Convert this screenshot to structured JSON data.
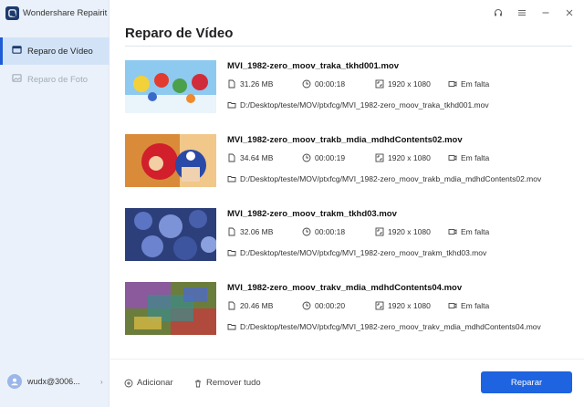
{
  "app": {
    "name": "Wondershare Repairit"
  },
  "sidebar": {
    "items": [
      {
        "label": "Reparo de Vídeo",
        "state": "active"
      },
      {
        "label": "Reparo de Foto",
        "state": "disabled"
      }
    ],
    "user": {
      "name": "wudx@3006..."
    }
  },
  "main": {
    "title": "Reparo de Vídeo",
    "files": [
      {
        "name": "MVI_1982-zero_moov_traka_tkhd001.mov",
        "size": "31.26 MB",
        "duration": "00:00:18",
        "resolution": "1920 x 1080",
        "status": "Em falta",
        "path": "D:/Desktop/teste/MOV/ptxfcg/MVI_1982-zero_moov_traka_tkhd001.mov"
      },
      {
        "name": "MVI_1982-zero_moov_trakb_mdia_mdhdContents02.mov",
        "size": "34.64 MB",
        "duration": "00:00:19",
        "resolution": "1920 x 1080",
        "status": "Em falta",
        "path": "D:/Desktop/teste/MOV/ptxfcg/MVI_1982-zero_moov_trakb_mdia_mdhdContents02.mov"
      },
      {
        "name": "MVI_1982-zero_moov_trakm_tkhd03.mov",
        "size": "32.06 MB",
        "duration": "00:00:18",
        "resolution": "1920 x 1080",
        "status": "Em falta",
        "path": "D:/Desktop/teste/MOV/ptxfcg/MVI_1982-zero_moov_trakm_tkhd03.mov"
      },
      {
        "name": "MVI_1982-zero_moov_trakv_mdia_mdhdContents04.mov",
        "size": "20.46 MB",
        "duration": "00:00:20",
        "resolution": "1920 x 1080",
        "status": "Em falta",
        "path": "D:/Desktop/teste/MOV/ptxfcg/MVI_1982-zero_moov_trakv_mdia_mdhdContents04.mov"
      }
    ]
  },
  "footer": {
    "add_label": "Adicionar",
    "remove_all_label": "Remover tudo",
    "repair_label": "Reparar"
  },
  "colors": {
    "accent": "#1e63e0",
    "sidebar_bg": "#eaf1fa",
    "active_item_bg": "#d3e3f7"
  },
  "icons": {
    "window": [
      "headset-icon",
      "menu-icon",
      "minimize-icon",
      "close-icon"
    ],
    "meta": [
      "file-icon",
      "clock-icon",
      "resolution-icon",
      "video-icon",
      "folder-icon"
    ]
  }
}
